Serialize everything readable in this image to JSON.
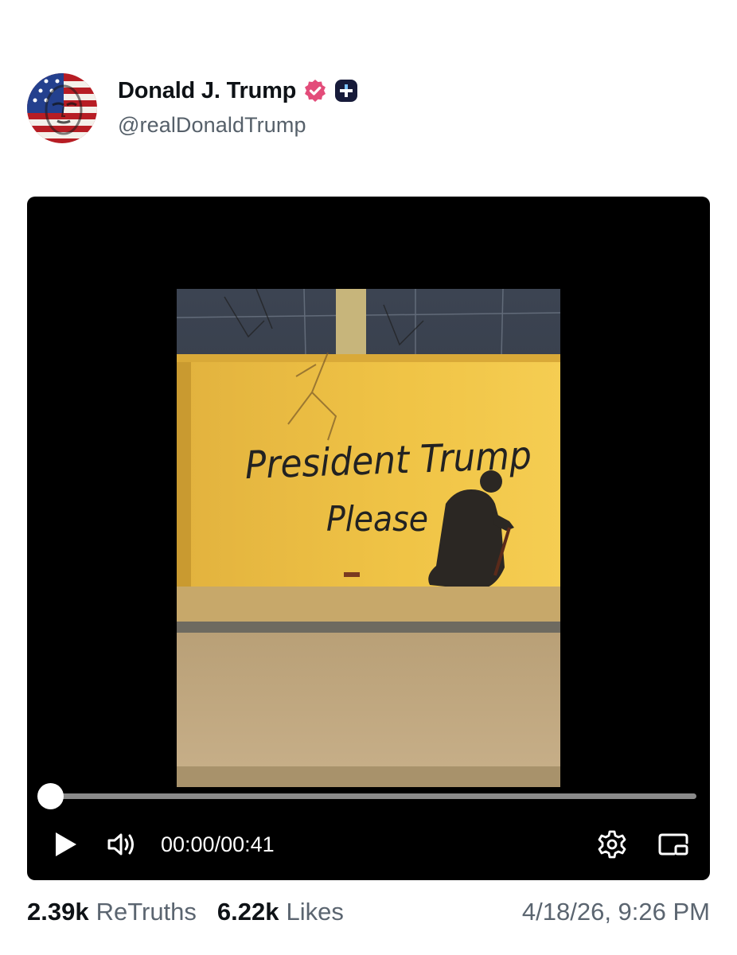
{
  "post": {
    "author": {
      "display_name": "Donald J. Trump",
      "handle": "@realDonaldTrump",
      "avatar_icon": "avatar-flag-portrait",
      "verified_badge_color": "#e34c7a"
    },
    "video": {
      "graffiti_line1": "President Trump",
      "graffiti_line2": "Please",
      "current_time": "00:00",
      "time_separator": "/",
      "duration": "00:41",
      "progress": 0.0
    },
    "stats": {
      "retruths_count": "2.39k",
      "retruths_label": "ReTruths",
      "likes_count": "6.22k",
      "likes_label": "Likes"
    },
    "timestamp": "4/18/26, 9:26 PM"
  }
}
